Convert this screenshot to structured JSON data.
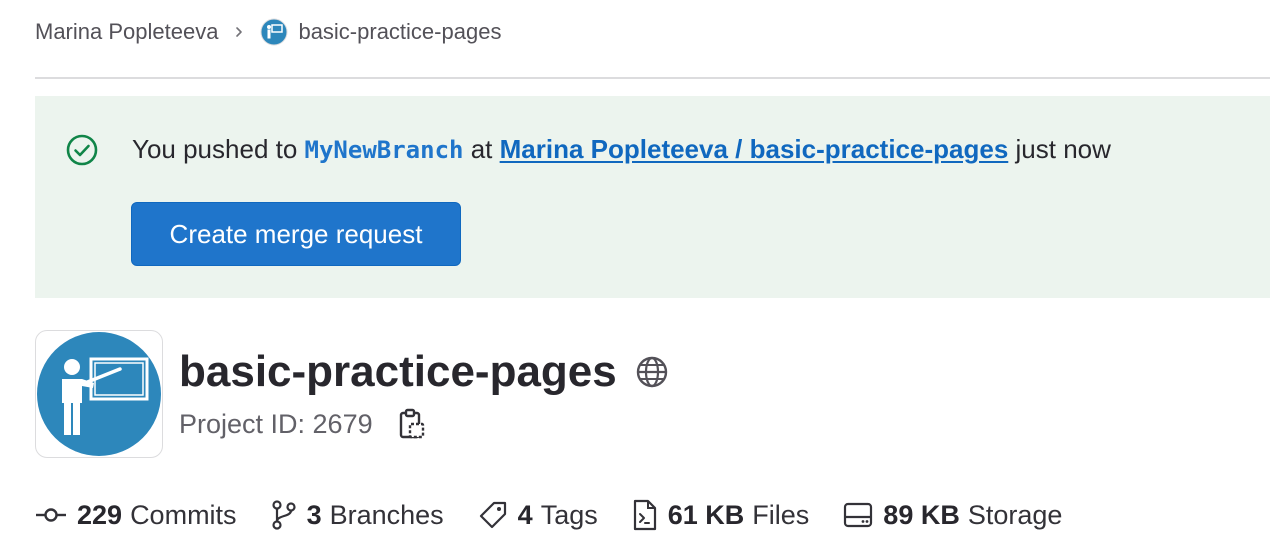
{
  "breadcrumb": {
    "owner": "Marina Popleteeva",
    "project": "basic-practice-pages"
  },
  "alert": {
    "prefix": "You pushed to ",
    "branch": "MyNewBranch",
    "middle": " at ",
    "link": "Marina Popleteeva / basic-practice-pages",
    "suffix": " just now",
    "button_label": "Create merge request",
    "icon": "check-circle-icon"
  },
  "project": {
    "name": "basic-practice-pages",
    "id_label": "Project ID: 2679",
    "visibility_icon": "globe-icon",
    "avatar_icon": "teacher-presentation-icon"
  },
  "stats": [
    {
      "icon": "commit-icon",
      "value": "229",
      "label": "Commits"
    },
    {
      "icon": "branch-icon",
      "value": "3",
      "label": "Branches"
    },
    {
      "icon": "tag-icon",
      "value": "4",
      "label": "Tags"
    },
    {
      "icon": "file-icon",
      "value": "61 KB",
      "label": "Files"
    },
    {
      "icon": "storage-icon",
      "value": "89 KB",
      "label": "Storage"
    }
  ],
  "colors": {
    "accent": "#1f75cb",
    "link": "#1068bf",
    "alert_bg": "#ecf4ee",
    "success": "#108548",
    "avatar_bg": "#2d87bb"
  }
}
